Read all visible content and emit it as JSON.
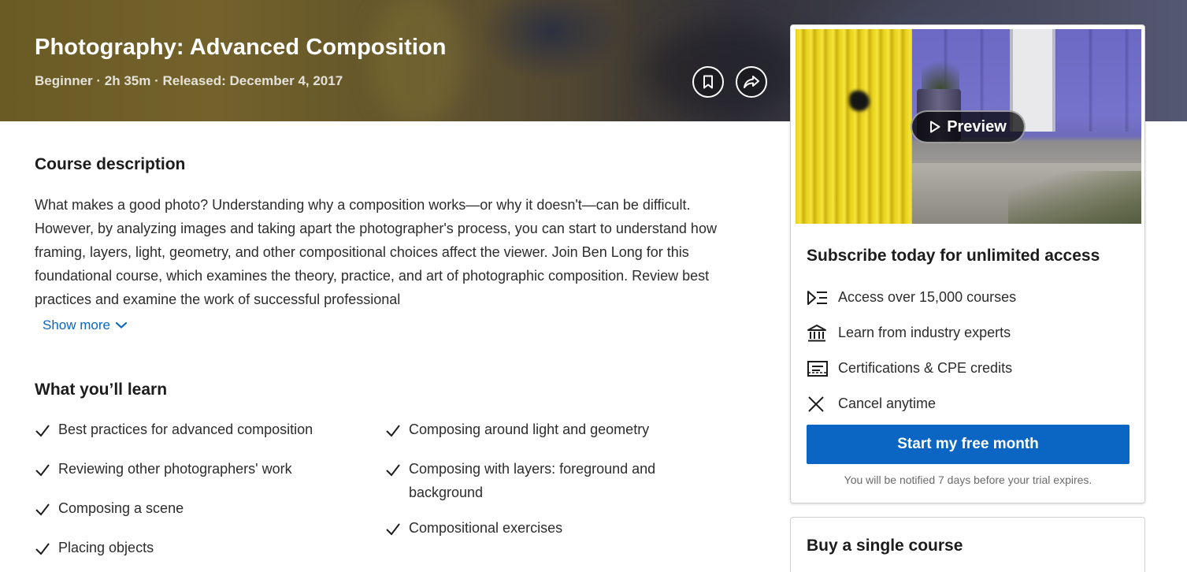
{
  "course": {
    "title": "Photography: Advanced Composition",
    "meta": "Beginner · 2h 35m · Released: December 4, 2017"
  },
  "hero_actions": {
    "save_icon": "bookmark-icon",
    "share_icon": "share-arrow-icon"
  },
  "description": {
    "heading": "Course description",
    "text": "What makes a good photo? Understanding why a composition works—or why it doesn't—can be difficult. However, by analyzing images and taking apart the photographer's process, you can start to understand how framing, layers, light, geometry, and other compositional choices affect the viewer. Join Ben Long for this foundational course, which examines the theory, practice, and art of photographic composition. Review best practices and examine the work of successful professional",
    "show_more": "Show more"
  },
  "learn": {
    "heading": "What you’ll learn",
    "column1": [
      "Best practices for advanced composition",
      "Reviewing other photographers' work",
      "Composing a scene",
      "Placing objects"
    ],
    "column2": [
      "Composing around light and geometry",
      "Composing with layers: foreground and background",
      "Compositional exercises"
    ]
  },
  "subscribe_card": {
    "preview_label": "Preview",
    "title": "Subscribe today for unlimited access",
    "benefits": [
      {
        "icon": "course-list-icon",
        "label": "Access over 15,000 courses"
      },
      {
        "icon": "institution-icon",
        "label": "Learn from industry experts"
      },
      {
        "icon": "certificate-icon",
        "label": "Certifications & CPE credits"
      },
      {
        "icon": "close-x-icon",
        "label": "Cancel anytime"
      }
    ],
    "cta": "Start my free month",
    "note": "You will be notified 7 days before your trial expires."
  },
  "single_card": {
    "title": "Buy a single course"
  },
  "colors": {
    "link": "#0a66c2",
    "cta_bg": "#0a66c2",
    "text": "#1c1c1c"
  }
}
